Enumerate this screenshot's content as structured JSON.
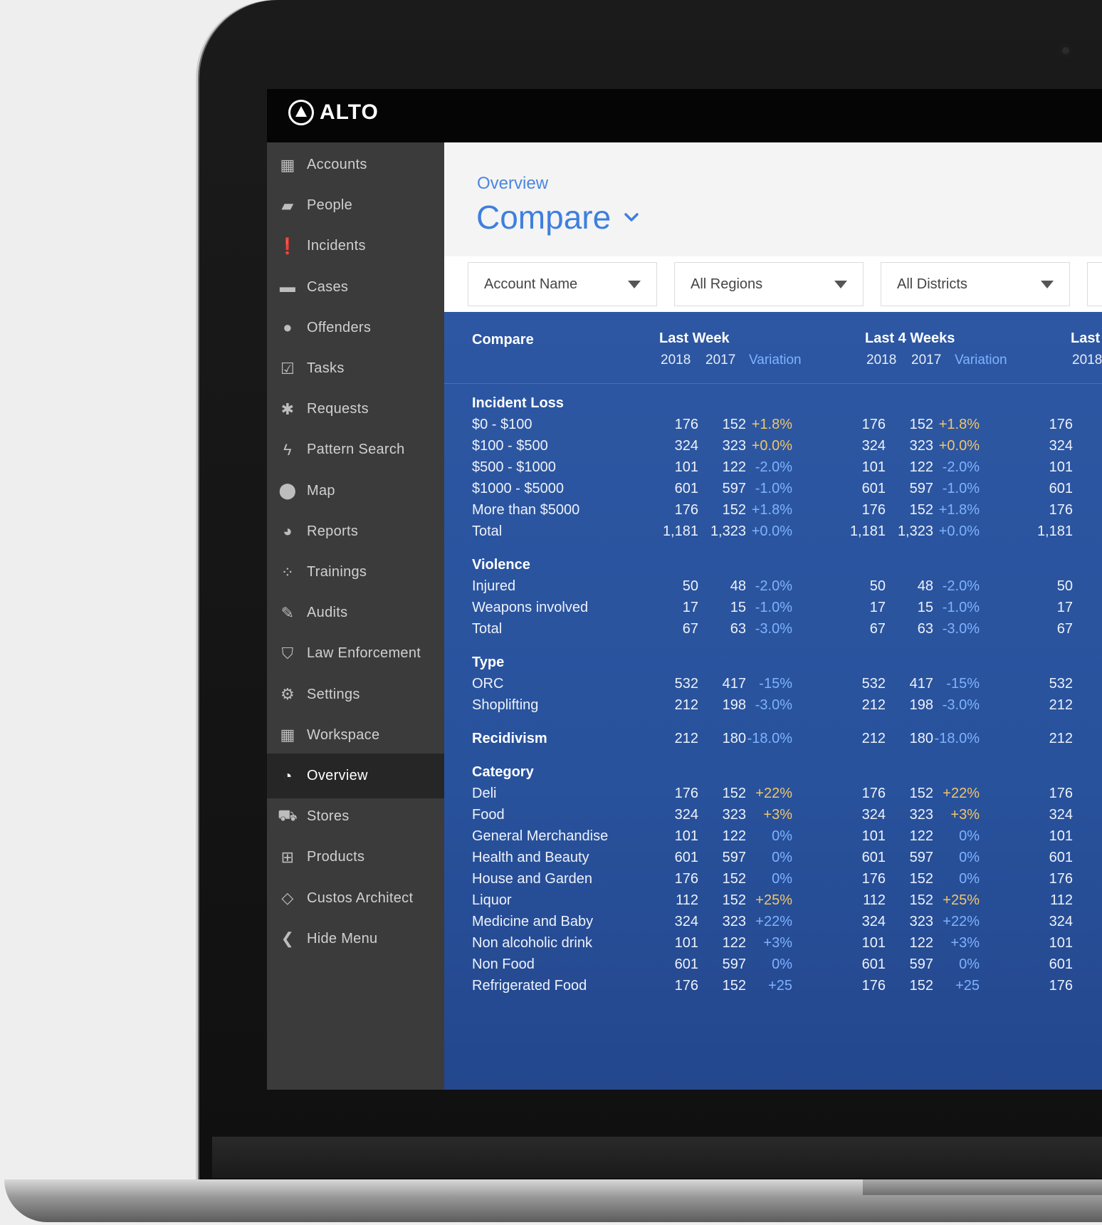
{
  "app": {
    "logo_text": "ALTO"
  },
  "sidebar": {
    "items": [
      {
        "label": "Accounts",
        "icon": "building-icon"
      },
      {
        "label": "People",
        "icon": "book-icon"
      },
      {
        "label": "Incidents",
        "icon": "exclamation-icon"
      },
      {
        "label": "Cases",
        "icon": "archive-icon"
      },
      {
        "label": "Offenders",
        "icon": "user-icon"
      },
      {
        "label": "Tasks",
        "icon": "checkbox-icon"
      },
      {
        "label": "Requests",
        "icon": "asterisk-icon"
      },
      {
        "label": "Pattern Search",
        "icon": "bolt-icon"
      },
      {
        "label": "Map",
        "icon": "map-pin-icon"
      },
      {
        "label": "Reports",
        "icon": "pie-chart-icon"
      },
      {
        "label": "Trainings",
        "icon": "spinner-icon"
      },
      {
        "label": "Audits",
        "icon": "edit-icon"
      },
      {
        "label": "Law Enforcement",
        "icon": "shield-icon"
      },
      {
        "label": "Settings",
        "icon": "gear-icon"
      },
      {
        "label": "Workspace",
        "icon": "calendar-icon"
      },
      {
        "label": "Overview",
        "icon": "dashboard-icon",
        "active": true
      },
      {
        "label": "Stores",
        "icon": "cart-icon"
      },
      {
        "label": "Products",
        "icon": "basket-icon"
      },
      {
        "label": "Custos Architect",
        "icon": "diamond-icon"
      },
      {
        "label": "Hide Menu",
        "icon": "chevron-left-circle-icon"
      }
    ]
  },
  "header": {
    "breadcrumb": "Overview",
    "title": "Compare"
  },
  "filters": [
    {
      "label": "Account Name"
    },
    {
      "label": "All Regions"
    },
    {
      "label": "All Districts"
    }
  ],
  "table": {
    "compare_label": "Compare",
    "periods": [
      {
        "title": "Last Week",
        "col2018": "2018",
        "col2017": "2017",
        "variation": "Variation"
      },
      {
        "title": "Last 4 Weeks",
        "col2018": "2018",
        "col2017": "2017",
        "variation": "Variation"
      },
      {
        "title": "Last",
        "col2018": "2018"
      }
    ],
    "rows": [
      {
        "kind": "group",
        "label": "Incident Loss"
      },
      {
        "kind": "row",
        "label": "$0 - $100",
        "a": "176",
        "b": "152",
        "v": "+1.8%",
        "tone": "pos",
        "c": "176",
        "d": "152",
        "w": "+1.8%",
        "e": "176"
      },
      {
        "kind": "row",
        "label": "$100 - $500",
        "a": "324",
        "b": "323",
        "v": "+0.0%",
        "tone": "pos",
        "c": "324",
        "d": "323",
        "w": "+0.0%",
        "e": "324"
      },
      {
        "kind": "row",
        "label": "$500 - $1000",
        "a": "101",
        "b": "122",
        "v": "-2.0%",
        "tone": "neg",
        "c": "101",
        "d": "122",
        "w": "-2.0%",
        "e": "101"
      },
      {
        "kind": "row",
        "label": "$1000 - $5000",
        "a": "601",
        "b": "597",
        "v": "-1.0%",
        "tone": "neg",
        "c": "601",
        "d": "597",
        "w": "-1.0%",
        "e": "601"
      },
      {
        "kind": "row",
        "label": "More than $5000",
        "a": "176",
        "b": "152",
        "v": "+1.8%",
        "tone": "neg",
        "c": "176",
        "d": "152",
        "w": "+1.8%",
        "e": "176"
      },
      {
        "kind": "row",
        "label": "Total",
        "a": "1,181",
        "b": "1,323",
        "v": "+0.0%",
        "tone": "neg",
        "c": "1,181",
        "d": "1,323",
        "w": "+0.0%",
        "e": "1,181"
      },
      {
        "kind": "group",
        "label": "Violence"
      },
      {
        "kind": "row",
        "label": "Injured",
        "a": "50",
        "b": "48",
        "v": "-2.0%",
        "tone": "neg",
        "c": "50",
        "d": "48",
        "w": "-2.0%",
        "e": "50"
      },
      {
        "kind": "row",
        "label": "Weapons involved",
        "a": "17",
        "b": "15",
        "v": "-1.0%",
        "tone": "neg",
        "c": "17",
        "d": "15",
        "w": "-1.0%",
        "e": "17"
      },
      {
        "kind": "row",
        "label": "Total",
        "a": "67",
        "b": "63",
        "v": "-3.0%",
        "tone": "neg",
        "c": "67",
        "d": "63",
        "w": "-3.0%",
        "e": "67"
      },
      {
        "kind": "group",
        "label": "Type"
      },
      {
        "kind": "row",
        "label": "ORC",
        "a": "532",
        "b": "417",
        "v": "-15%",
        "tone": "neg",
        "c": "532",
        "d": "417",
        "w": "-15%",
        "e": "532"
      },
      {
        "kind": "row",
        "label": "Shoplifting",
        "a": "212",
        "b": "198",
        "v": "-3.0%",
        "tone": "neg",
        "c": "212",
        "d": "198",
        "w": "-3.0%",
        "e": "212"
      },
      {
        "kind": "grouprow",
        "label": "Recidivism",
        "a": "212",
        "b": "180",
        "v": "-18.0%",
        "tone": "neg",
        "c": "212",
        "d": "180",
        "w": "-18.0%",
        "e": "212"
      },
      {
        "kind": "group",
        "label": "Category"
      },
      {
        "kind": "row",
        "label": "Deli",
        "a": "176",
        "b": "152",
        "v": "+22%",
        "tone": "pos",
        "c": "176",
        "d": "152",
        "w": "+22%",
        "e": "176"
      },
      {
        "kind": "row",
        "label": "Food",
        "a": "324",
        "b": "323",
        "v": "+3%",
        "tone": "pos",
        "c": "324",
        "d": "323",
        "w": "+3%",
        "e": "324"
      },
      {
        "kind": "row",
        "label": "General Merchandise",
        "a": "101",
        "b": "122",
        "v": "0%",
        "tone": "neg",
        "c": "101",
        "d": "122",
        "w": "0%",
        "e": "101"
      },
      {
        "kind": "row",
        "label": "Health and Beauty",
        "a": "601",
        "b": "597",
        "v": "0%",
        "tone": "neg",
        "c": "601",
        "d": "597",
        "w": "0%",
        "e": "601"
      },
      {
        "kind": "row",
        "label": "House and Garden",
        "a": "176",
        "b": "152",
        "v": "0%",
        "tone": "neg",
        "c": "176",
        "d": "152",
        "w": "0%",
        "e": "176"
      },
      {
        "kind": "row",
        "label": "Liquor",
        "a": "112",
        "b": "152",
        "v": "+25%",
        "tone": "pos",
        "c": "112",
        "d": "152",
        "w": "+25%",
        "e": "112"
      },
      {
        "kind": "row",
        "label": "Medicine and Baby",
        "a": "324",
        "b": "323",
        "v": "+22%",
        "tone": "neg",
        "c": "324",
        "d": "323",
        "w": "+22%",
        "e": "324"
      },
      {
        "kind": "row",
        "label": "Non alcoholic drink",
        "a": "101",
        "b": "122",
        "v": "+3%",
        "tone": "neg",
        "c": "101",
        "d": "122",
        "w": "+3%",
        "e": "101"
      },
      {
        "kind": "row",
        "label": "Non Food",
        "a": "601",
        "b": "597",
        "v": "0%",
        "tone": "neg",
        "c": "601",
        "d": "597",
        "w": "0%",
        "e": "601"
      },
      {
        "kind": "row",
        "label": "Refrigerated Food",
        "a": "176",
        "b": "152",
        "v": "+25",
        "tone": "neg",
        "c": "176",
        "d": "152",
        "w": "+25",
        "e": "176"
      }
    ]
  },
  "colors": {
    "accent": "#3f7fde",
    "panel": "#2a549f",
    "positive": "#f1c56a",
    "negative": "#7fb2ff"
  }
}
